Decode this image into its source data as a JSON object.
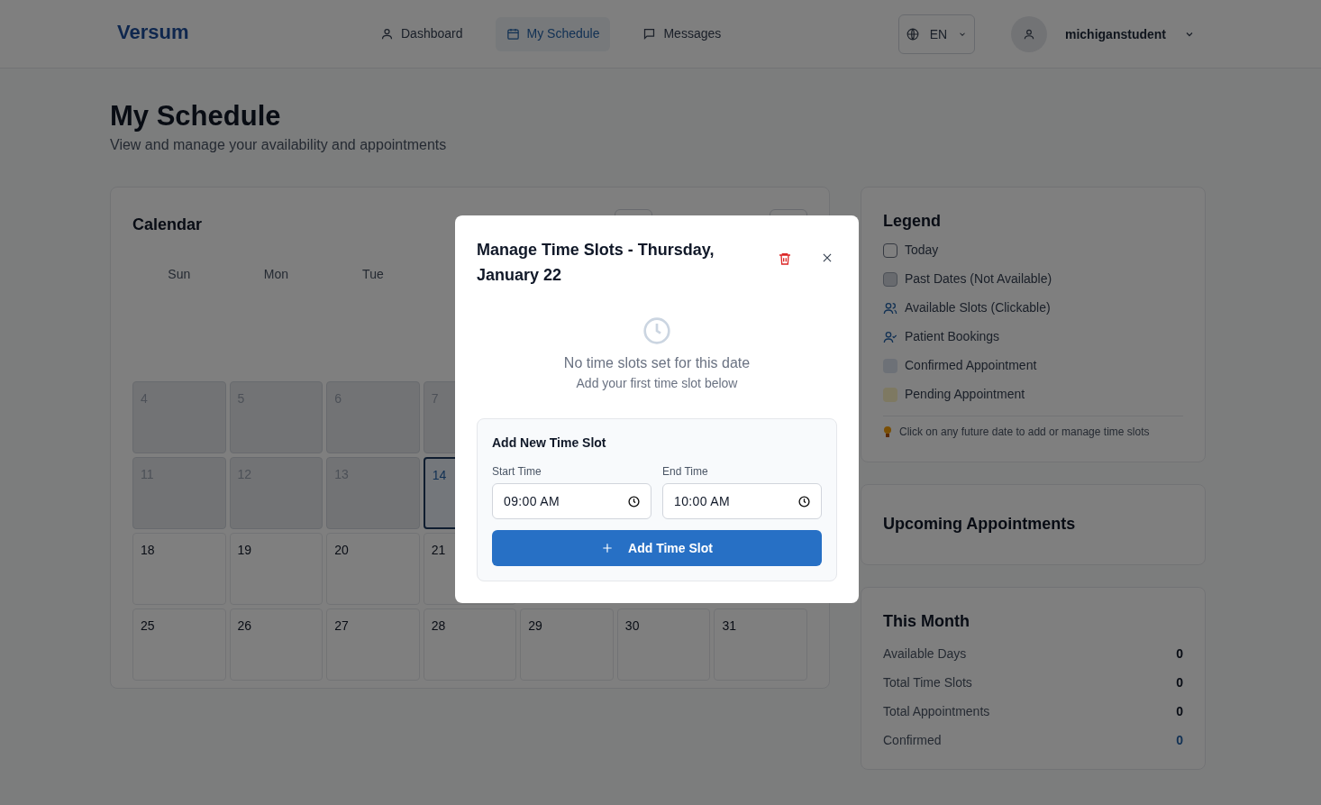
{
  "header": {
    "logo": "Versum",
    "nav": [
      {
        "label": "Dashboard",
        "selected": false
      },
      {
        "label": "My Schedule",
        "selected": true
      },
      {
        "label": "Messages",
        "selected": false
      }
    ],
    "language": "EN",
    "username": "michiganstudent"
  },
  "page": {
    "title": "My Schedule",
    "subtitle": "View and manage your availability and appointments"
  },
  "calendar": {
    "title": "Calendar",
    "weekdays": [
      "Sun",
      "Mon",
      "Tue"
    ],
    "weeks": [
      [
        {
          "day": "4",
          "past": true,
          "today": false
        },
        {
          "day": "5",
          "past": true,
          "today": false
        },
        {
          "day": "6",
          "past": true,
          "today": false
        },
        {
          "day": "7",
          "past": true,
          "today": false
        }
      ],
      [
        {
          "day": "11",
          "past": true,
          "today": false
        },
        {
          "day": "12",
          "past": true,
          "today": false
        },
        {
          "day": "13",
          "past": true,
          "today": false
        },
        {
          "day": "14",
          "past": false,
          "today": true
        }
      ],
      [
        {
          "day": "18",
          "past": false,
          "today": false
        },
        {
          "day": "19",
          "past": false,
          "today": false
        },
        {
          "day": "20",
          "past": false,
          "today": false
        },
        {
          "day": "21",
          "past": false,
          "today": false
        }
      ],
      [
        {
          "day": "25",
          "past": false,
          "today": false
        },
        {
          "day": "26",
          "past": false,
          "today": false
        },
        {
          "day": "27",
          "past": false,
          "today": false
        },
        {
          "day": "28",
          "past": false,
          "today": false
        },
        {
          "day": "29",
          "past": false,
          "today": false
        },
        {
          "day": "30",
          "past": false,
          "today": false
        },
        {
          "day": "31",
          "past": false,
          "today": false
        }
      ]
    ]
  },
  "legend": {
    "title": "Legend",
    "items": [
      {
        "kind": "today",
        "label": "Today"
      },
      {
        "kind": "past",
        "label": "Past Dates (Not Available)"
      },
      {
        "kind": "available",
        "label": "Available Slots (Clickable)"
      },
      {
        "kind": "bookings",
        "label": "Patient Bookings"
      },
      {
        "kind": "confirmed",
        "label": "Confirmed Appointment"
      },
      {
        "kind": "pending",
        "label": "Pending Appointment"
      }
    ],
    "tip": "Click on any future date to add or manage time slots"
  },
  "upcoming": {
    "title": "Upcoming Appointments"
  },
  "this_month": {
    "title": "This Month",
    "stats": [
      {
        "label": "Available Days",
        "value": "0",
        "highlight": false
      },
      {
        "label": "Total Time Slots",
        "value": "0",
        "highlight": false
      },
      {
        "label": "Total Appointments",
        "value": "0",
        "highlight": false
      },
      {
        "label": "Confirmed",
        "value": "0",
        "highlight": true
      }
    ]
  },
  "modal": {
    "title": "Manage Time Slots - Thursday, January 22",
    "empty_title": "No time slots set for this date",
    "empty_subtitle": "Add your first time slot below",
    "form_title": "Add New Time Slot",
    "start_label": "Start Time",
    "start_value": "09:00 AM",
    "end_label": "End Time",
    "end_value": "10:00 AM",
    "add_button": "Add Time Slot"
  }
}
